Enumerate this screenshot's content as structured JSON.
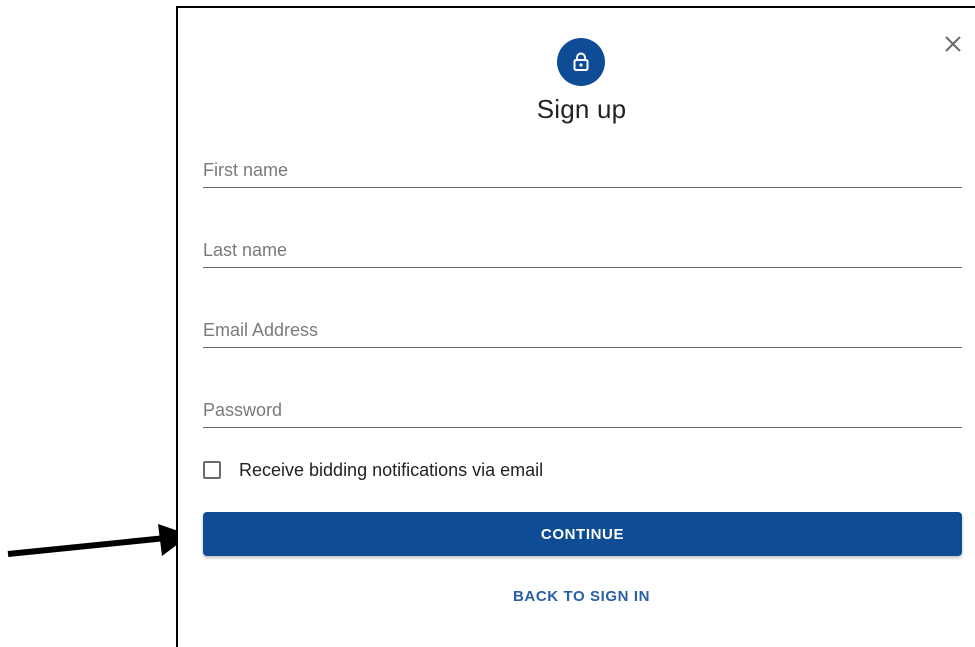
{
  "dialog": {
    "title": "Sign up",
    "close_icon": "close-icon",
    "lock_icon": "lock-icon",
    "accent_color": "#0f4c96"
  },
  "form": {
    "first_name": {
      "placeholder": "First name",
      "value": ""
    },
    "last_name": {
      "placeholder": "Last name",
      "value": ""
    },
    "email": {
      "placeholder": "Email Address",
      "value": ""
    },
    "password": {
      "placeholder": "Password",
      "value": ""
    },
    "notifications_checkbox": {
      "label": "Receive bidding notifications via email",
      "checked": false
    }
  },
  "actions": {
    "continue_label": "CONTINUE",
    "back_label": "BACK TO SIGN IN"
  },
  "annotation": {
    "arrow_icon": "arrow-right-icon"
  }
}
